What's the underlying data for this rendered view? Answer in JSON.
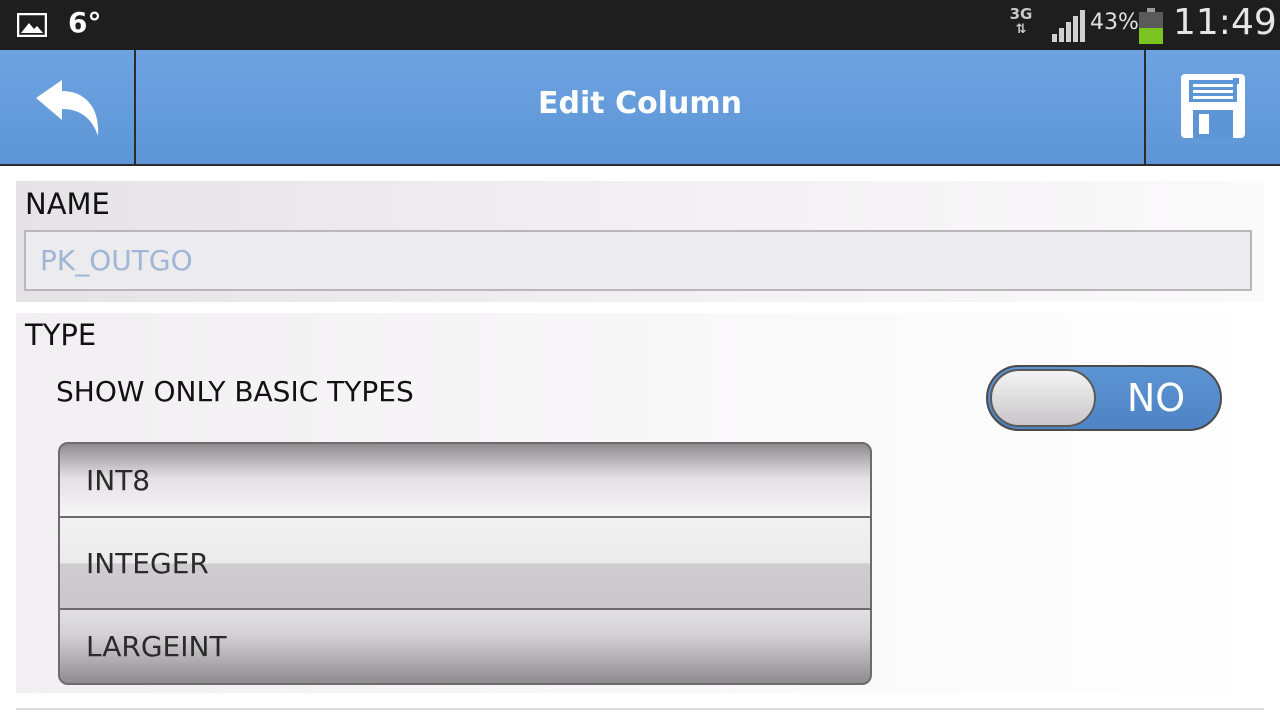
{
  "status_bar": {
    "gallery_icon": "gallery-icon",
    "temperature": "6°",
    "network_type": "3G",
    "network_arrows": "⇅",
    "signal_icon": "signal-icon",
    "battery_percent": "43%",
    "battery_icon": "battery-icon",
    "time": "11:49"
  },
  "action_bar": {
    "back_icon": "back-arrow-icon",
    "title": "Edit Column",
    "save_icon": "save-floppy-icon",
    "background_color": "#5d95d6"
  },
  "name_section": {
    "label": "NAME",
    "input_value": "PK_OUTGO"
  },
  "type_section": {
    "label": "TYPE",
    "basic_types_label": "SHOW ONLY BASIC TYPES",
    "toggle_state": "NO",
    "picker": {
      "items": [
        "INT8",
        "INTEGER",
        "LARGEINT"
      ],
      "selected": "INTEGER"
    }
  }
}
